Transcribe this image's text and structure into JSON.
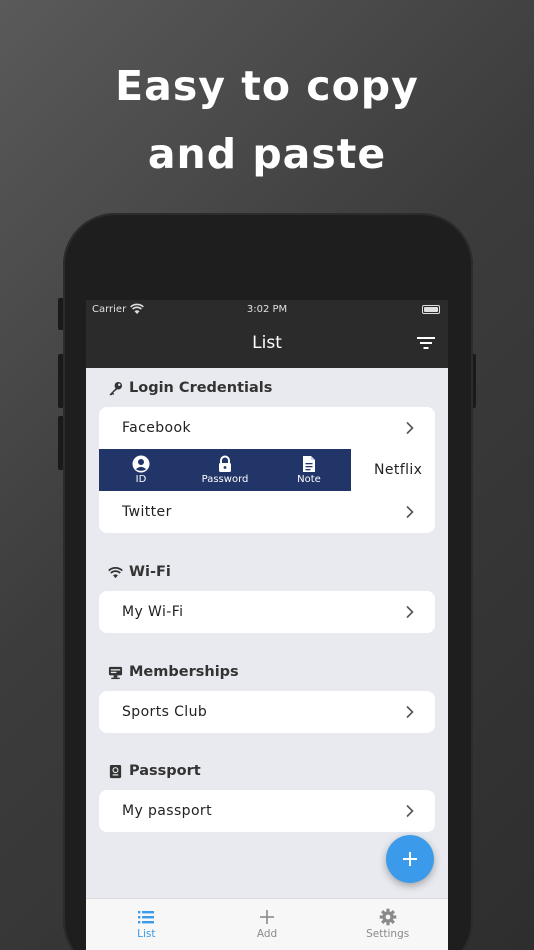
{
  "headline": {
    "line1": "Easy to copy",
    "line2": "and paste"
  },
  "status_bar": {
    "carrier": "Carrier",
    "time": "3:02 PM"
  },
  "nav": {
    "title": "List"
  },
  "sections": {
    "login": {
      "title": "Login Credentials",
      "items": [
        "Facebook",
        "Netflix",
        "Twitter"
      ]
    },
    "wifi": {
      "title": "Wi-Fi",
      "items": [
        "My Wi-Fi"
      ]
    },
    "memberships": {
      "title": "Memberships",
      "items": [
        "Sports Club"
      ]
    },
    "passport": {
      "title": "Passport",
      "items": [
        "My passport"
      ]
    }
  },
  "swipe_actions": {
    "id": "ID",
    "password": "Password",
    "note": "Note"
  },
  "tabbar": {
    "list": "List",
    "add": "Add",
    "settings": "Settings"
  },
  "colors": {
    "accent": "#3b9bea",
    "swipe_bg": "#213568",
    "nav_bg": "#2b2b2b",
    "screen_bg": "#e8eaef"
  }
}
